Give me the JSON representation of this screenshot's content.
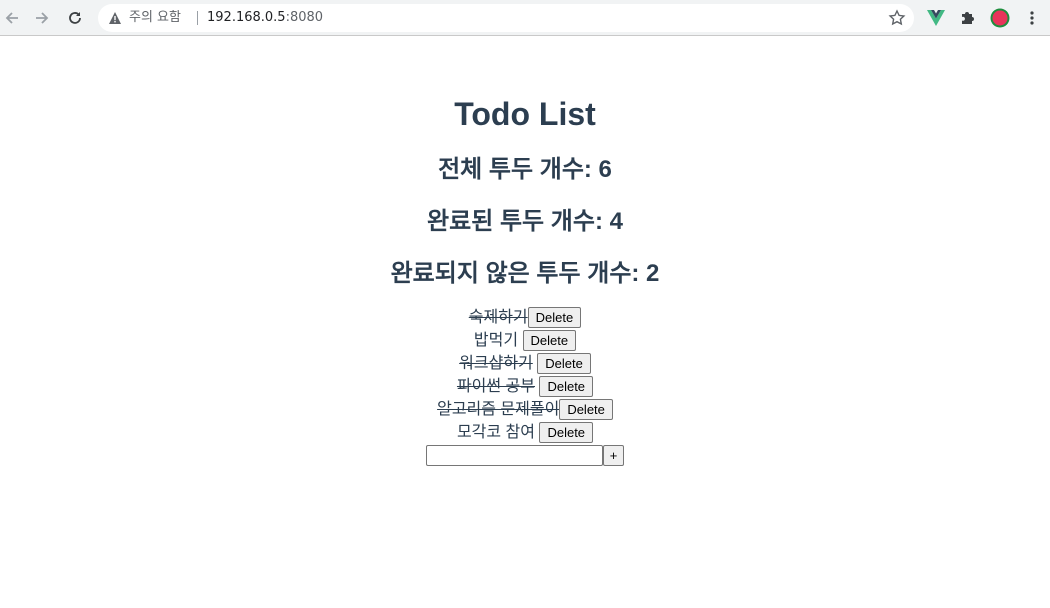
{
  "browser": {
    "security_label": "주의 요함",
    "url_host": "192.168.0.5",
    "url_port": ":8080",
    "icons": [
      "back-icon",
      "forward-icon",
      "reload-icon",
      "warning-icon",
      "star-icon",
      "vue-devtools-icon",
      "extensions-icon",
      "profile-icon",
      "menu-icon"
    ]
  },
  "app": {
    "title": "Todo List",
    "total_label": "전체 투두 개수: 6",
    "done_label": "완료된 투두 개수: 4",
    "undone_label": "완료되지 않은 투두 개수: 2",
    "delete_label": "Delete",
    "add_label": "+",
    "input_value": "",
    "todos": [
      {
        "text": "숙제하기",
        "done": true
      },
      {
        "text": "밥먹기",
        "done": false
      },
      {
        "text": "워크샵하기",
        "done": true
      },
      {
        "text": "파이썬 공부",
        "done": true
      },
      {
        "text": "알고리즘 문제풀이",
        "done": true
      },
      {
        "text": "모각코 참여",
        "done": false
      }
    ]
  },
  "colors": {
    "text": "#2c3e50",
    "toolbar": "#f1f3f4",
    "vue_green": "#41b883",
    "profile_red": "#e8345a"
  }
}
